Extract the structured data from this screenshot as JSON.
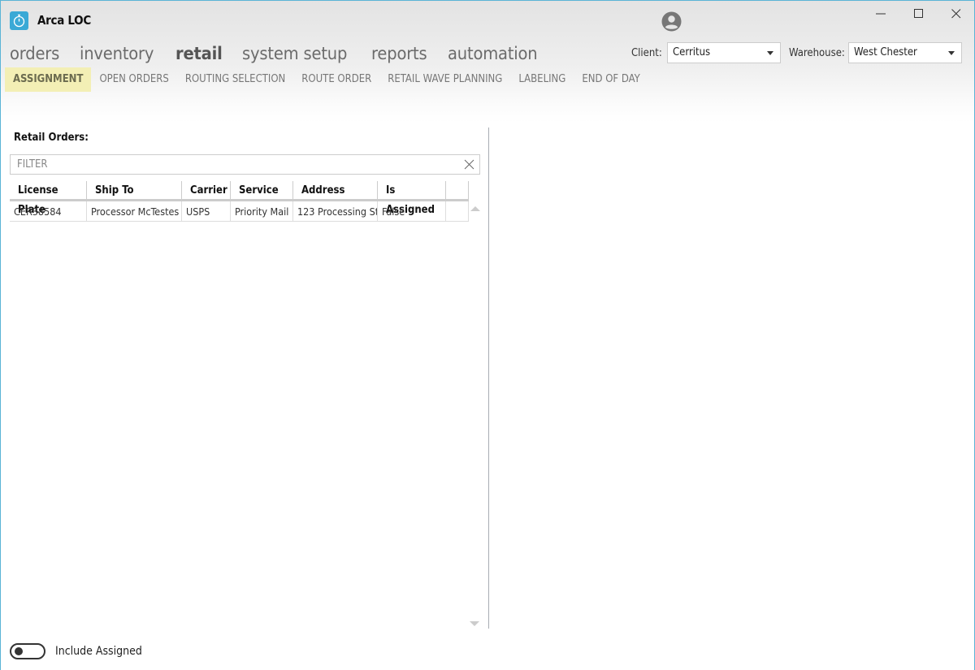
{
  "app": {
    "title": "Arca LOC",
    "icon": "stopwatch-icon"
  },
  "window_controls": {
    "minimize": "minimize-icon",
    "maximize": "maximize-icon",
    "close": "close-icon"
  },
  "user": {
    "icon": "user-account-icon"
  },
  "main_nav": [
    {
      "label": "orders",
      "active": false
    },
    {
      "label": "inventory",
      "active": false
    },
    {
      "label": "retail",
      "active": true
    },
    {
      "label": "system setup",
      "active": false
    },
    {
      "label": "reports",
      "active": false
    },
    {
      "label": "automation",
      "active": false
    }
  ],
  "sub_nav": [
    {
      "label": "ASSIGNMENT",
      "active": true
    },
    {
      "label": "OPEN ORDERS",
      "active": false
    },
    {
      "label": "ROUTING SELECTION",
      "active": false
    },
    {
      "label": "ROUTE ORDER",
      "active": false
    },
    {
      "label": "RETAIL WAVE PLANNING",
      "active": false
    },
    {
      "label": "LABELING",
      "active": false
    },
    {
      "label": "END OF DAY",
      "active": false
    }
  ],
  "filters": {
    "client_label": "Client:",
    "client_value": "Cerritus",
    "warehouse_label": "Warehouse:",
    "warehouse_value": "West Chester"
  },
  "retail_orders": {
    "title": "Retail Orders:",
    "filter_placeholder": "FILTER",
    "filter_value": "",
    "columns": [
      "License Plate",
      "Ship To",
      "Carrier",
      "Service",
      "Address",
      "Is Assigned"
    ],
    "rows": [
      [
        "CER38584",
        "Processor McTestes",
        "USPS",
        "Priority Mail",
        "123 Processing St",
        "False"
      ]
    ]
  },
  "include_assigned": {
    "label": "Include Assigned",
    "on": false
  },
  "colors": {
    "accent": "#3aa9d6",
    "active_tab_bg": "#f3efb5",
    "window_border": "#5ab4d6"
  }
}
